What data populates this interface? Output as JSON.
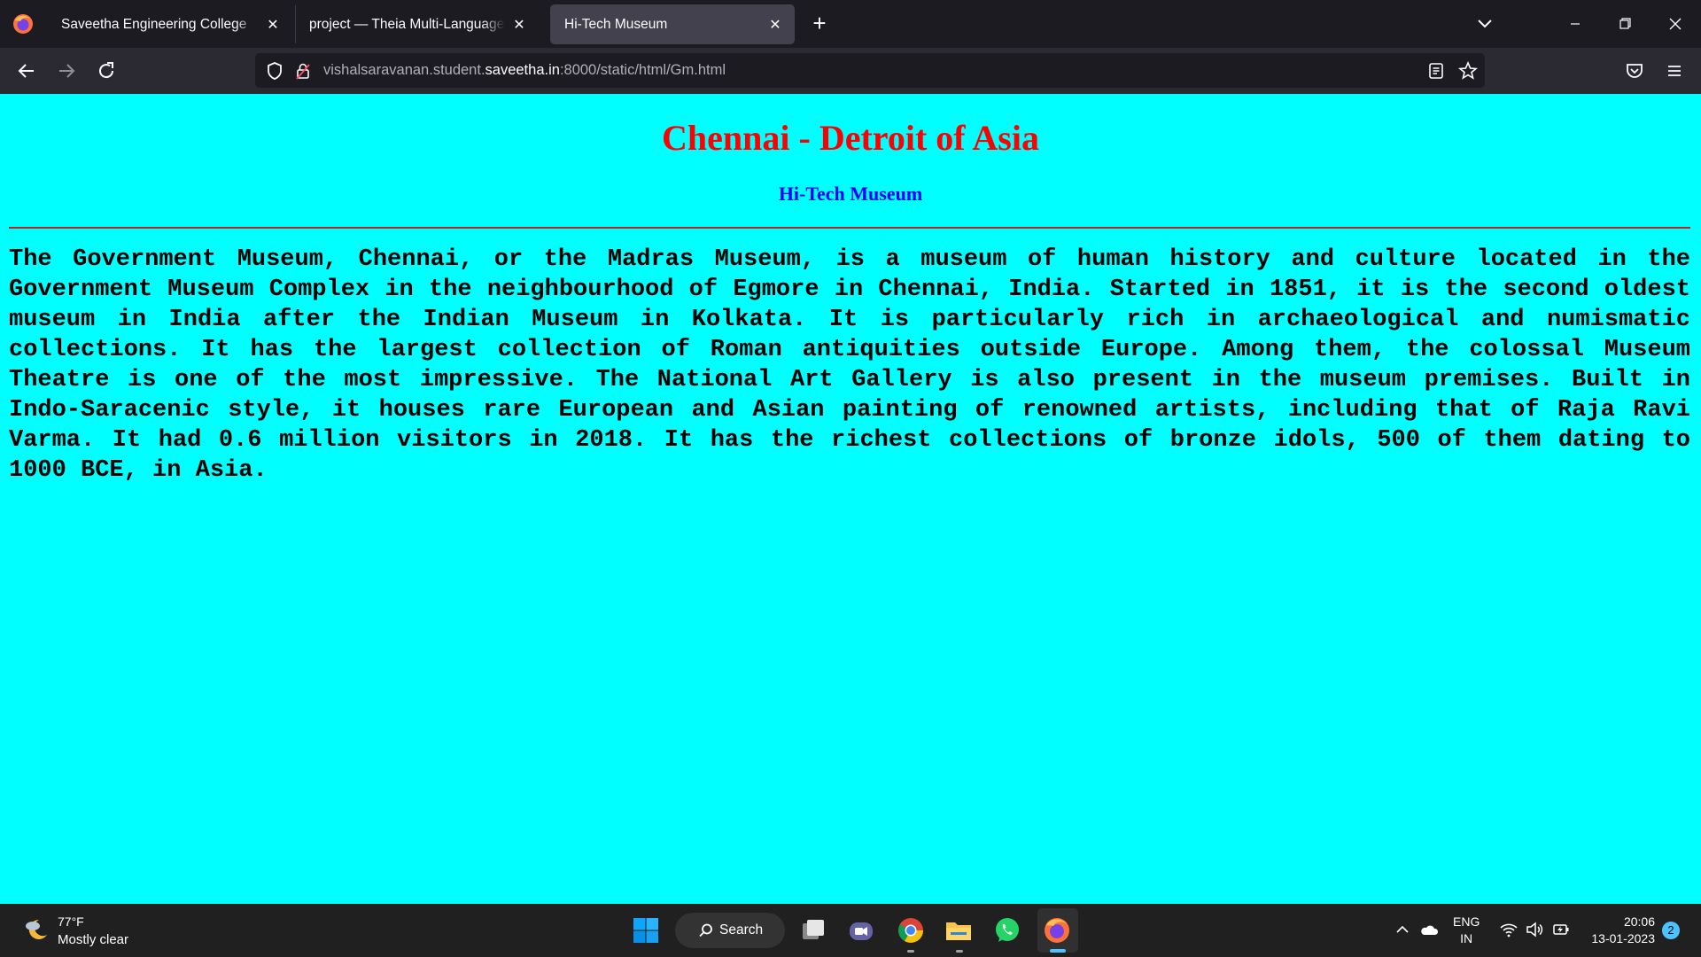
{
  "browser": {
    "tabs": [
      {
        "title": "Saveetha Engineering College",
        "active": false
      },
      {
        "title": "project — Theia Multi-Language Example",
        "active": false
      },
      {
        "title": "Hi-Tech Museum",
        "active": true
      }
    ],
    "url": {
      "prefix": "vishalsaravanan.student.",
      "host": "saveetha.in",
      "suffix": ":8000/static/html/Gm.html"
    }
  },
  "page": {
    "heading": "Chennai - Detroit of Asia",
    "subheading": "Hi-Tech Museum",
    "body_text": "The Government Museum, Chennai, or the Madras Museum, is a museum of human history and culture located in the Government Museum Complex in the neighbourhood of Egmore in Chennai, India. Started in 1851, it is the second oldest museum in India after the Indian Museum in Kolkata. It is particularly rich in archaeological and numismatic collections. It has the largest collection of Roman antiquities outside Europe. Among them, the colossal Museum Theatre is one of the most impressive. The National Art Gallery is also present in the museum premises. Built in Indo-Saracenic style, it houses rare European and Asian painting of renowned artists, including that of Raja Ravi Varma. It had 0.6 million visitors in 2018. It has the richest collections of bronze idols, 500 of them dating to 1000 BCE, in Asia.",
    "colors": {
      "background": "#00ffff",
      "heading": "#ff0000",
      "subheading": "#0000ff",
      "text": "#000000"
    }
  },
  "taskbar": {
    "weather": {
      "temp": "77°F",
      "condition": "Mostly clear"
    },
    "search_label": "Search",
    "language": {
      "line1": "ENG",
      "line2": "IN"
    },
    "clock": {
      "time": "20:06",
      "date": "13-01-2023"
    },
    "notification_count": "2"
  }
}
